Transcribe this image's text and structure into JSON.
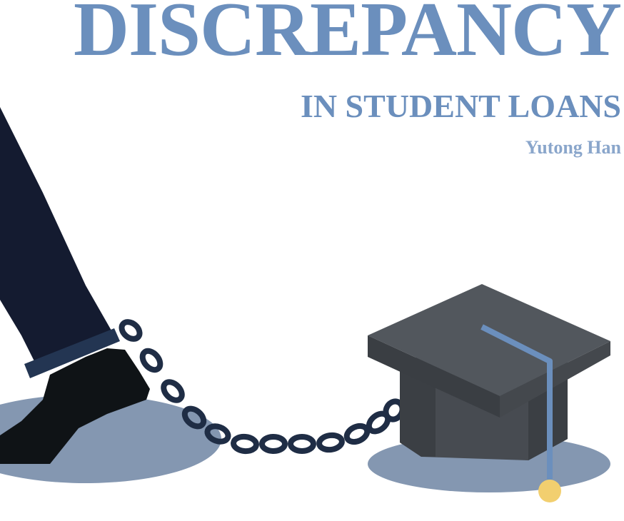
{
  "header": {
    "title": "DISCREPANCY",
    "subtitle": "IN STUDENT LOANS",
    "author": "Yutong Han"
  },
  "colors": {
    "accent": "#6b8fbd",
    "author": "#8aa6cb",
    "shadow": "#8497b1",
    "pants": "#141b30",
    "cuff": "#233552",
    "shoe": "#0f1316",
    "chain": "#1f2d45",
    "cap_top": "#52575d",
    "cap_base": "#474b51",
    "tassel": "#6b8fbd",
    "tassel_ball": "#f2cf6f"
  },
  "illustration": {
    "elements": [
      "leg-in-trousers",
      "shoe",
      "ankle-shackle",
      "chain",
      "graduation-cap-weight",
      "tassel"
    ]
  }
}
